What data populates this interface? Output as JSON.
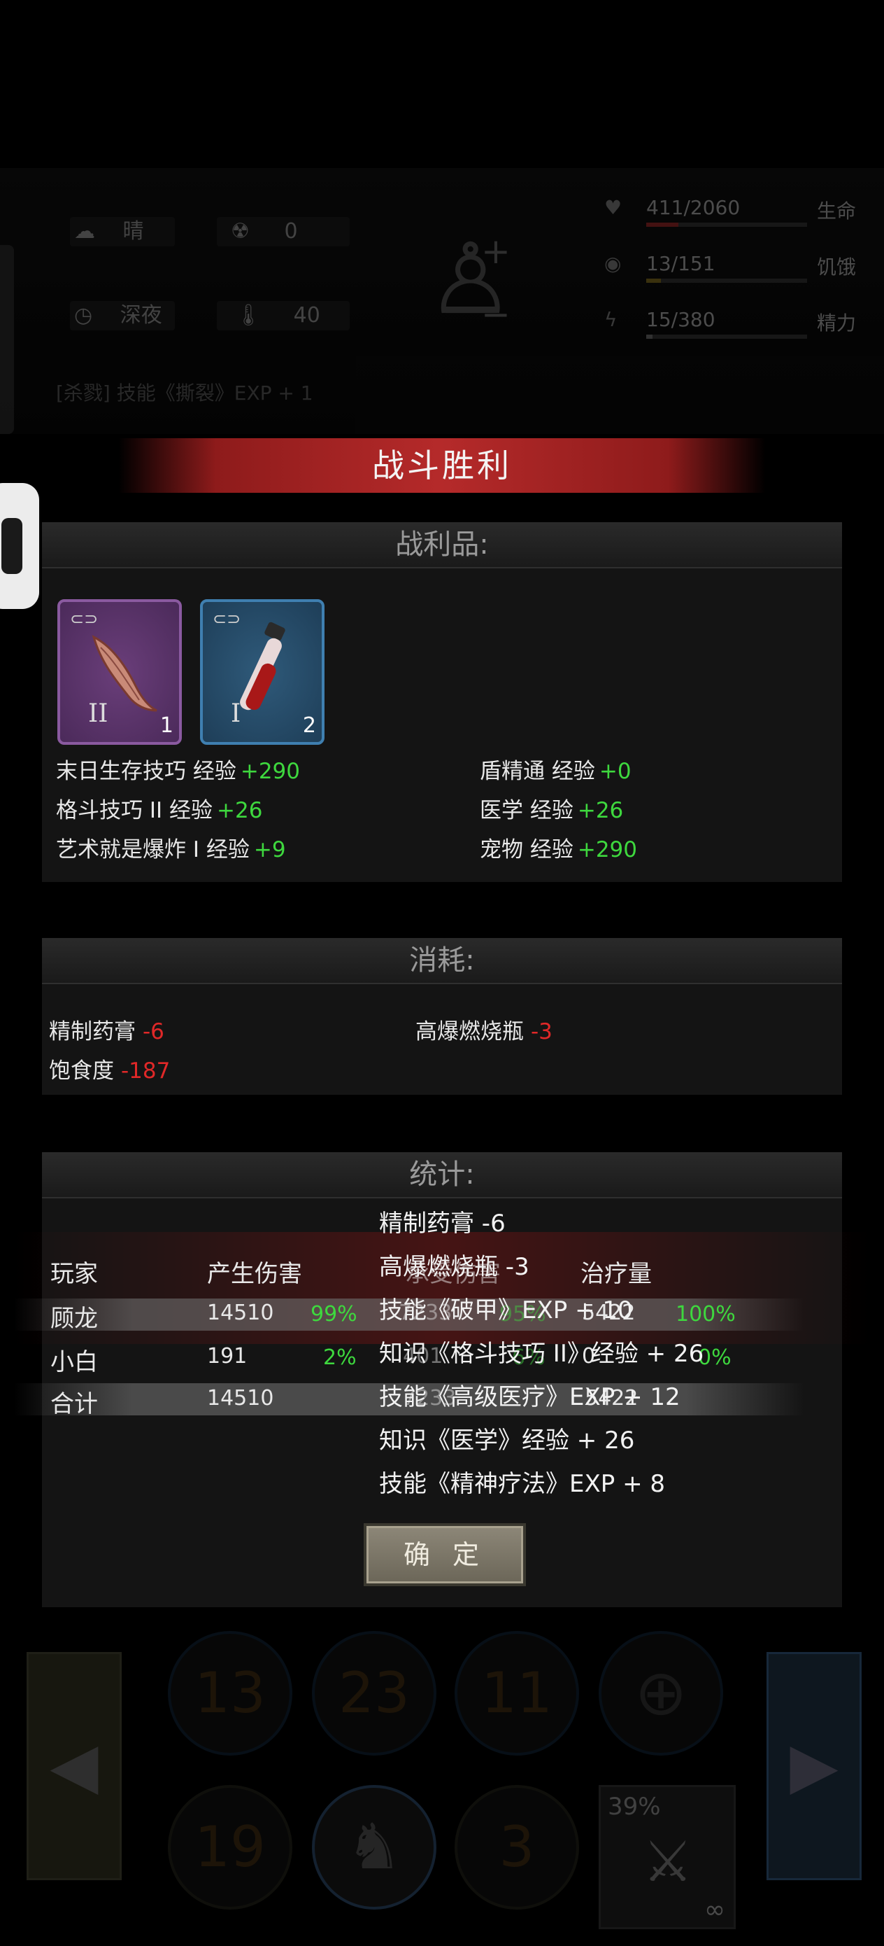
{
  "hud": {
    "weather": "晴",
    "radiation": "0",
    "time": "深夜",
    "temperature": "40",
    "life_value": "411/2060",
    "life_label": "生命",
    "life_fraction": 0.2,
    "hunger_value": "13/151",
    "hunger_label": "饥饿",
    "hunger_fraction": 0.09,
    "energy_value": "15/380",
    "energy_label": "精力",
    "energy_fraction": 0.04,
    "log_line": "[杀戮] 技能《撕裂》EXP + 1"
  },
  "banner": {
    "title": "战斗胜利"
  },
  "loot": {
    "header": "战利品:",
    "items": [
      {
        "name": "muscle-item",
        "level": "II",
        "count": "1"
      },
      {
        "name": "blood-vial-item",
        "level": "I",
        "count": "2"
      }
    ],
    "xp_left": [
      {
        "skill": "末日生存技巧 经验",
        "gain": "+290"
      },
      {
        "skill": "格斗技巧 II 经验",
        "gain": "+26"
      },
      {
        "skill": "艺术就是爆炸 I 经验",
        "gain": "+9"
      }
    ],
    "xp_right": [
      {
        "skill": "盾精通 经验",
        "gain": "+0"
      },
      {
        "skill": "医学 经验",
        "gain": "+26"
      },
      {
        "skill": "宠物 经验",
        "gain": "+290"
      }
    ]
  },
  "consume": {
    "header": "消耗:",
    "items": [
      {
        "name": "精制药膏",
        "value": "-6"
      },
      {
        "name": "高爆燃烧瓶",
        "value": "-3"
      },
      {
        "name": "饱食度",
        "value": "-187"
      }
    ]
  },
  "stats": {
    "header": "统计:",
    "columns": [
      "玩家",
      "产生伤害",
      "承受伤害",
      "治疗量"
    ],
    "rows": [
      {
        "player": "顾龙",
        "damage": "14510",
        "damage_pct": "99%",
        "taken": "7233",
        "taken_pct": "95%",
        "heal": "5422",
        "heal_pct": "100%"
      },
      {
        "player": "小白",
        "damage": "191",
        "damage_pct": "2%",
        "taken": "401",
        "taken_pct": "6%",
        "heal": "0",
        "heal_pct": "0%"
      },
      {
        "player": "合计",
        "damage": "14510",
        "damage_pct": "",
        "taken": "7233",
        "taken_pct": "",
        "heal": "5422",
        "heal_pct": ""
      }
    ]
  },
  "overlay_log": [
    "精制药膏 -6",
    "高爆燃烧瓶 -3",
    "技能《破甲》EXP + 10",
    "知识《格斗技巧 II》经验 + 26",
    "技能《高级医疗》EXP + 12",
    "知识《医学》经验 + 26",
    "技能《精神疗法》EXP + 8"
  ],
  "confirm_label": "确 定",
  "controls": {
    "counters": [
      "13",
      "23",
      "11"
    ],
    "bottom_counters": [
      "19",
      "3"
    ],
    "weapon_durability": "39%",
    "weapon_ammo": "∞"
  }
}
